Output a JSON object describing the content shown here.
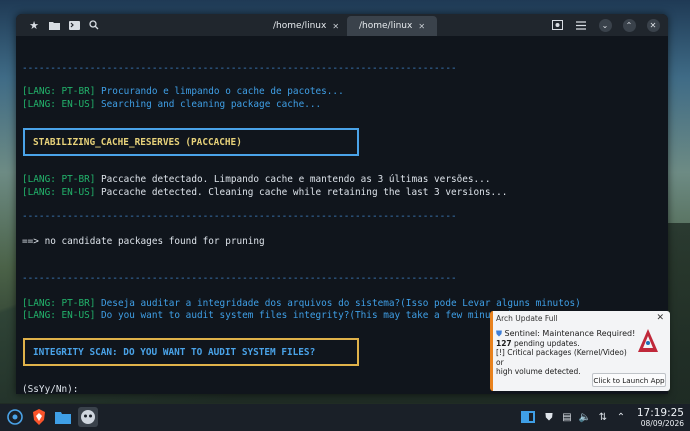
{
  "window": {
    "tabs": [
      {
        "label": "/home/linux",
        "active": false
      },
      {
        "label": "/home/linux",
        "active": true
      }
    ]
  },
  "terminal": {
    "separator": "-----------------------------------------------------------------------------",
    "block1": {
      "pt_tag": "[LANG: PT-BR]",
      "pt_text": " Procurando e limpando o cache de pacotes...",
      "en_tag": "[LANG: EN-US]",
      "en_text": " Searching and cleaning package cache..."
    },
    "box_cache": "STABILIZING_CACHE_RESERVES (PACCACHE)",
    "block2": {
      "pt_tag": "[LANG: PT-BR]",
      "pt_text": " Paccache detectado. Limpando cache e mantendo as 3 últimas versões...",
      "en_tag": "[LANG: EN-US]",
      "en_text": " Paccache detected. Cleaning cache while retaining the last 3 versions..."
    },
    "output": "==> no candidate packages found for pruning",
    "block3": {
      "pt_tag": "[LANG: PT-BR]",
      "pt_text": " Deseja auditar a integridade dos arquivos do sistema?(Isso pode Levar alguns minutos)",
      "en_tag": "[LANG: EN-US]",
      "en_text": " Do you want to audit system files integrity?(This may take a few minutes)"
    },
    "box_scan": "INTEGRITY SCAN: DO YOU WANT TO AUDIT SYSTEM FILES?",
    "prompt": "(SsYy/Nn):"
  },
  "notification": {
    "app": "Arch Update Full",
    "heading": "Sentinel: Maintenance Required!",
    "count": "127",
    "count_suffix": " pending updates.",
    "line3": "[!] Critical packages (Kernel/Video) or",
    "line4": "high volume detected.",
    "button": "Click to Launch App"
  },
  "taskbar": {
    "time": "17:19:25",
    "date": "08/09/2026"
  },
  "colors": {
    "accent_blue": "#3f9fe6",
    "lang_green": "#22b36b",
    "box_yellow": "#e7d27a",
    "notif_accent": "#e8821e"
  }
}
